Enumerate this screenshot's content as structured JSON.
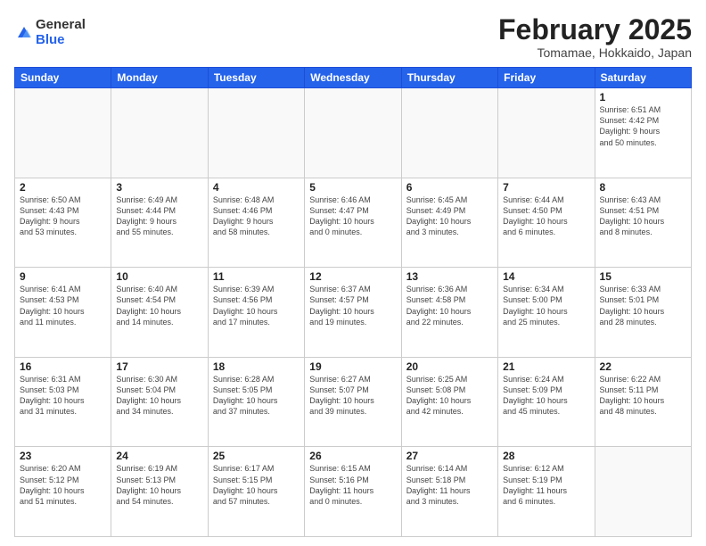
{
  "logo": {
    "general": "General",
    "blue": "Blue"
  },
  "title": "February 2025",
  "location": "Tomamae, Hokkaido, Japan",
  "weekdays": [
    "Sunday",
    "Monday",
    "Tuesday",
    "Wednesday",
    "Thursday",
    "Friday",
    "Saturday"
  ],
  "days": [
    {
      "num": "",
      "info": ""
    },
    {
      "num": "",
      "info": ""
    },
    {
      "num": "",
      "info": ""
    },
    {
      "num": "",
      "info": ""
    },
    {
      "num": "",
      "info": ""
    },
    {
      "num": "",
      "info": ""
    },
    {
      "num": "1",
      "info": "Sunrise: 6:51 AM\nSunset: 4:42 PM\nDaylight: 9 hours\nand 50 minutes."
    },
    {
      "num": "2",
      "info": "Sunrise: 6:50 AM\nSunset: 4:43 PM\nDaylight: 9 hours\nand 53 minutes."
    },
    {
      "num": "3",
      "info": "Sunrise: 6:49 AM\nSunset: 4:44 PM\nDaylight: 9 hours\nand 55 minutes."
    },
    {
      "num": "4",
      "info": "Sunrise: 6:48 AM\nSunset: 4:46 PM\nDaylight: 9 hours\nand 58 minutes."
    },
    {
      "num": "5",
      "info": "Sunrise: 6:46 AM\nSunset: 4:47 PM\nDaylight: 10 hours\nand 0 minutes."
    },
    {
      "num": "6",
      "info": "Sunrise: 6:45 AM\nSunset: 4:49 PM\nDaylight: 10 hours\nand 3 minutes."
    },
    {
      "num": "7",
      "info": "Sunrise: 6:44 AM\nSunset: 4:50 PM\nDaylight: 10 hours\nand 6 minutes."
    },
    {
      "num": "8",
      "info": "Sunrise: 6:43 AM\nSunset: 4:51 PM\nDaylight: 10 hours\nand 8 minutes."
    },
    {
      "num": "9",
      "info": "Sunrise: 6:41 AM\nSunset: 4:53 PM\nDaylight: 10 hours\nand 11 minutes."
    },
    {
      "num": "10",
      "info": "Sunrise: 6:40 AM\nSunset: 4:54 PM\nDaylight: 10 hours\nand 14 minutes."
    },
    {
      "num": "11",
      "info": "Sunrise: 6:39 AM\nSunset: 4:56 PM\nDaylight: 10 hours\nand 17 minutes."
    },
    {
      "num": "12",
      "info": "Sunrise: 6:37 AM\nSunset: 4:57 PM\nDaylight: 10 hours\nand 19 minutes."
    },
    {
      "num": "13",
      "info": "Sunrise: 6:36 AM\nSunset: 4:58 PM\nDaylight: 10 hours\nand 22 minutes."
    },
    {
      "num": "14",
      "info": "Sunrise: 6:34 AM\nSunset: 5:00 PM\nDaylight: 10 hours\nand 25 minutes."
    },
    {
      "num": "15",
      "info": "Sunrise: 6:33 AM\nSunset: 5:01 PM\nDaylight: 10 hours\nand 28 minutes."
    },
    {
      "num": "16",
      "info": "Sunrise: 6:31 AM\nSunset: 5:03 PM\nDaylight: 10 hours\nand 31 minutes."
    },
    {
      "num": "17",
      "info": "Sunrise: 6:30 AM\nSunset: 5:04 PM\nDaylight: 10 hours\nand 34 minutes."
    },
    {
      "num": "18",
      "info": "Sunrise: 6:28 AM\nSunset: 5:05 PM\nDaylight: 10 hours\nand 37 minutes."
    },
    {
      "num": "19",
      "info": "Sunrise: 6:27 AM\nSunset: 5:07 PM\nDaylight: 10 hours\nand 39 minutes."
    },
    {
      "num": "20",
      "info": "Sunrise: 6:25 AM\nSunset: 5:08 PM\nDaylight: 10 hours\nand 42 minutes."
    },
    {
      "num": "21",
      "info": "Sunrise: 6:24 AM\nSunset: 5:09 PM\nDaylight: 10 hours\nand 45 minutes."
    },
    {
      "num": "22",
      "info": "Sunrise: 6:22 AM\nSunset: 5:11 PM\nDaylight: 10 hours\nand 48 minutes."
    },
    {
      "num": "23",
      "info": "Sunrise: 6:20 AM\nSunset: 5:12 PM\nDaylight: 10 hours\nand 51 minutes."
    },
    {
      "num": "24",
      "info": "Sunrise: 6:19 AM\nSunset: 5:13 PM\nDaylight: 10 hours\nand 54 minutes."
    },
    {
      "num": "25",
      "info": "Sunrise: 6:17 AM\nSunset: 5:15 PM\nDaylight: 10 hours\nand 57 minutes."
    },
    {
      "num": "26",
      "info": "Sunrise: 6:15 AM\nSunset: 5:16 PM\nDaylight: 11 hours\nand 0 minutes."
    },
    {
      "num": "27",
      "info": "Sunrise: 6:14 AM\nSunset: 5:18 PM\nDaylight: 11 hours\nand 3 minutes."
    },
    {
      "num": "28",
      "info": "Sunrise: 6:12 AM\nSunset: 5:19 PM\nDaylight: 11 hours\nand 6 minutes."
    },
    {
      "num": "",
      "info": ""
    },
    {
      "num": "",
      "info": ""
    },
    {
      "num": "",
      "info": ""
    },
    {
      "num": "",
      "info": ""
    },
    {
      "num": "",
      "info": ""
    }
  ]
}
